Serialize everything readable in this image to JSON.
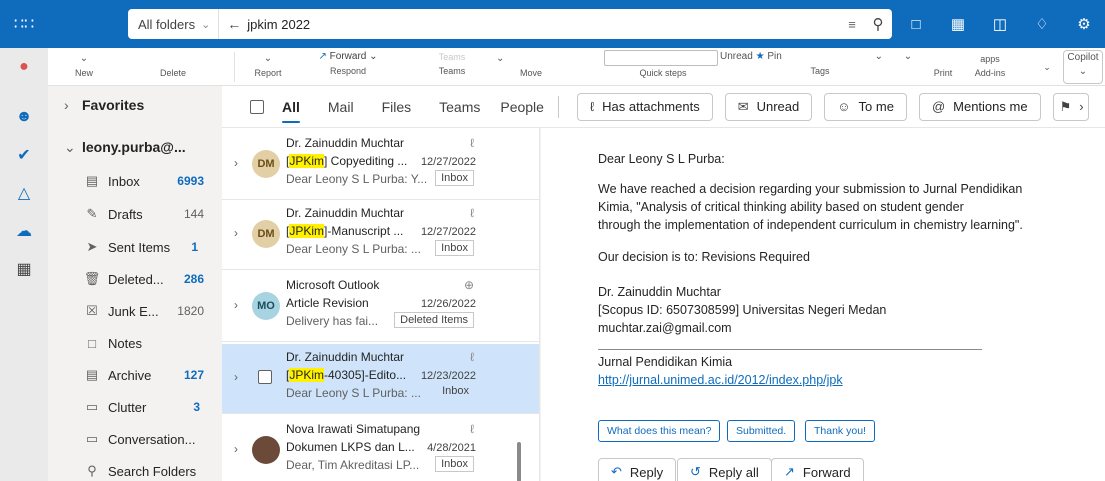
{
  "colors": {
    "brand": "#0f6cbd",
    "selected_row": "#cfe4fa",
    "highlight": "#fff100"
  },
  "search": {
    "scope": "All folders",
    "query": "jpkim 2022"
  },
  "ribbon": {
    "new": "New",
    "delete": "Delete",
    "report": "Report",
    "forward": "Forward",
    "respond": "Respond",
    "teams_top": "Teams",
    "teams": "Teams",
    "move": "Move",
    "quick_steps": "Quick steps",
    "unread": "Unread",
    "pin": "Pin",
    "tags": "Tags",
    "print": "Print",
    "apps": "apps",
    "addins": "Add-ins",
    "copilot": "Copilot"
  },
  "folders": {
    "favorites": "Favorites",
    "account": "leony.purba@...",
    "items": [
      {
        "name": "Inbox",
        "count": "6993",
        "icon": "inbox-icon",
        "count_style": "blue-bold"
      },
      {
        "name": "Drafts",
        "count": "144",
        "icon": "pencil-icon",
        "count_style": "gray"
      },
      {
        "name": "Sent Items",
        "count": "1",
        "icon": "send-icon",
        "count_style": "blue-bold"
      },
      {
        "name": "Deleted...",
        "count": "286",
        "icon": "trash-icon",
        "count_style": "blue-bold"
      },
      {
        "name": "Junk E...",
        "count": "1820",
        "icon": "junk-icon",
        "count_style": "gray"
      },
      {
        "name": "Notes",
        "count": "",
        "icon": "note-icon",
        "count_style": "gray"
      },
      {
        "name": "Archive",
        "count": "127",
        "icon": "archive-icon",
        "count_style": "blue-bold"
      },
      {
        "name": "Clutter",
        "count": "3",
        "icon": "folder-icon",
        "count_style": "blue-bold"
      },
      {
        "name": "Conversation...",
        "count": "",
        "icon": "folder-icon",
        "count_style": "gray"
      },
      {
        "name": "Search Folders",
        "count": "",
        "icon": "search-folder-icon",
        "count_style": "gray"
      }
    ]
  },
  "filterbar": {
    "tabs": [
      "All",
      "Mail",
      "Files",
      "Teams",
      "People"
    ],
    "buttons": [
      "Has attachments",
      "Unread",
      "To me",
      "Mentions me"
    ]
  },
  "messages": [
    {
      "initials": "DM",
      "sender": "Dr. Zainuddin Muchtar",
      "subject_hl": "JPKim",
      "subject_rest": "] Copyediting ...",
      "subject_pre": "[",
      "date": "12/27/2022",
      "preview": "Dear Leony S L Purba: Y...",
      "folder": "Inbox"
    },
    {
      "initials": "DM",
      "sender": "Dr. Zainuddin Muchtar",
      "subject_hl": "JPKim",
      "subject_rest": "]-Manuscript ...",
      "subject_pre": "[",
      "date": "12/27/2022",
      "preview": "Dear Leony S L Purba: ...",
      "folder": "Inbox"
    },
    {
      "initials": "MO",
      "sender": "Microsoft Outlook",
      "subject_hl": "",
      "subject_rest": "Article Revision",
      "subject_pre": "",
      "date": "12/26/2022",
      "preview": "Delivery has fai...",
      "folder": "Deleted Items"
    },
    {
      "initials": "",
      "sender": "Dr. Zainuddin Muchtar",
      "subject_hl": "JPKim",
      "subject_rest": "-40305]-Edito...",
      "subject_pre": "[",
      "date": "12/23/2022",
      "preview": "Dear Leony S L Purba: ...",
      "folder": "Inbox"
    },
    {
      "initials": "",
      "sender": "Nova Irawati Simatupang",
      "subject_hl": "",
      "subject_rest": "Dokumen LKPS dan L...",
      "subject_pre": "",
      "date": "4/28/2021",
      "preview": "Dear, Tim Akreditasi LP...",
      "folder": "Inbox"
    }
  ],
  "reading": {
    "greeting": "Dear Leony S L Purba:",
    "body1": "We have reached a decision regarding your submission to Jurnal Pendidikan",
    "body2": "Kimia, \"Analysis of critical thinking ability based on student gender",
    "body3": "through the implementation of independent curriculum in chemistry learning\".",
    "decision": "Our decision is to: Revisions Required",
    "sig_name": "Dr. Zainuddin Muchtar",
    "sig_scopus": "[Scopus ID: 6507308599] Universitas Negeri Medan",
    "sig_email": "muchtar.zai@gmail.com",
    "journal": "Jurnal Pendidikan Kimia",
    "journal_url": "http://jurnal.unimed.ac.id/2012/index.php/jpk",
    "suggestions": [
      "What does this mean?",
      "Submitted.",
      "Thank you!"
    ],
    "reply": "Reply",
    "reply_all": "Reply all",
    "forward": "Forward"
  }
}
